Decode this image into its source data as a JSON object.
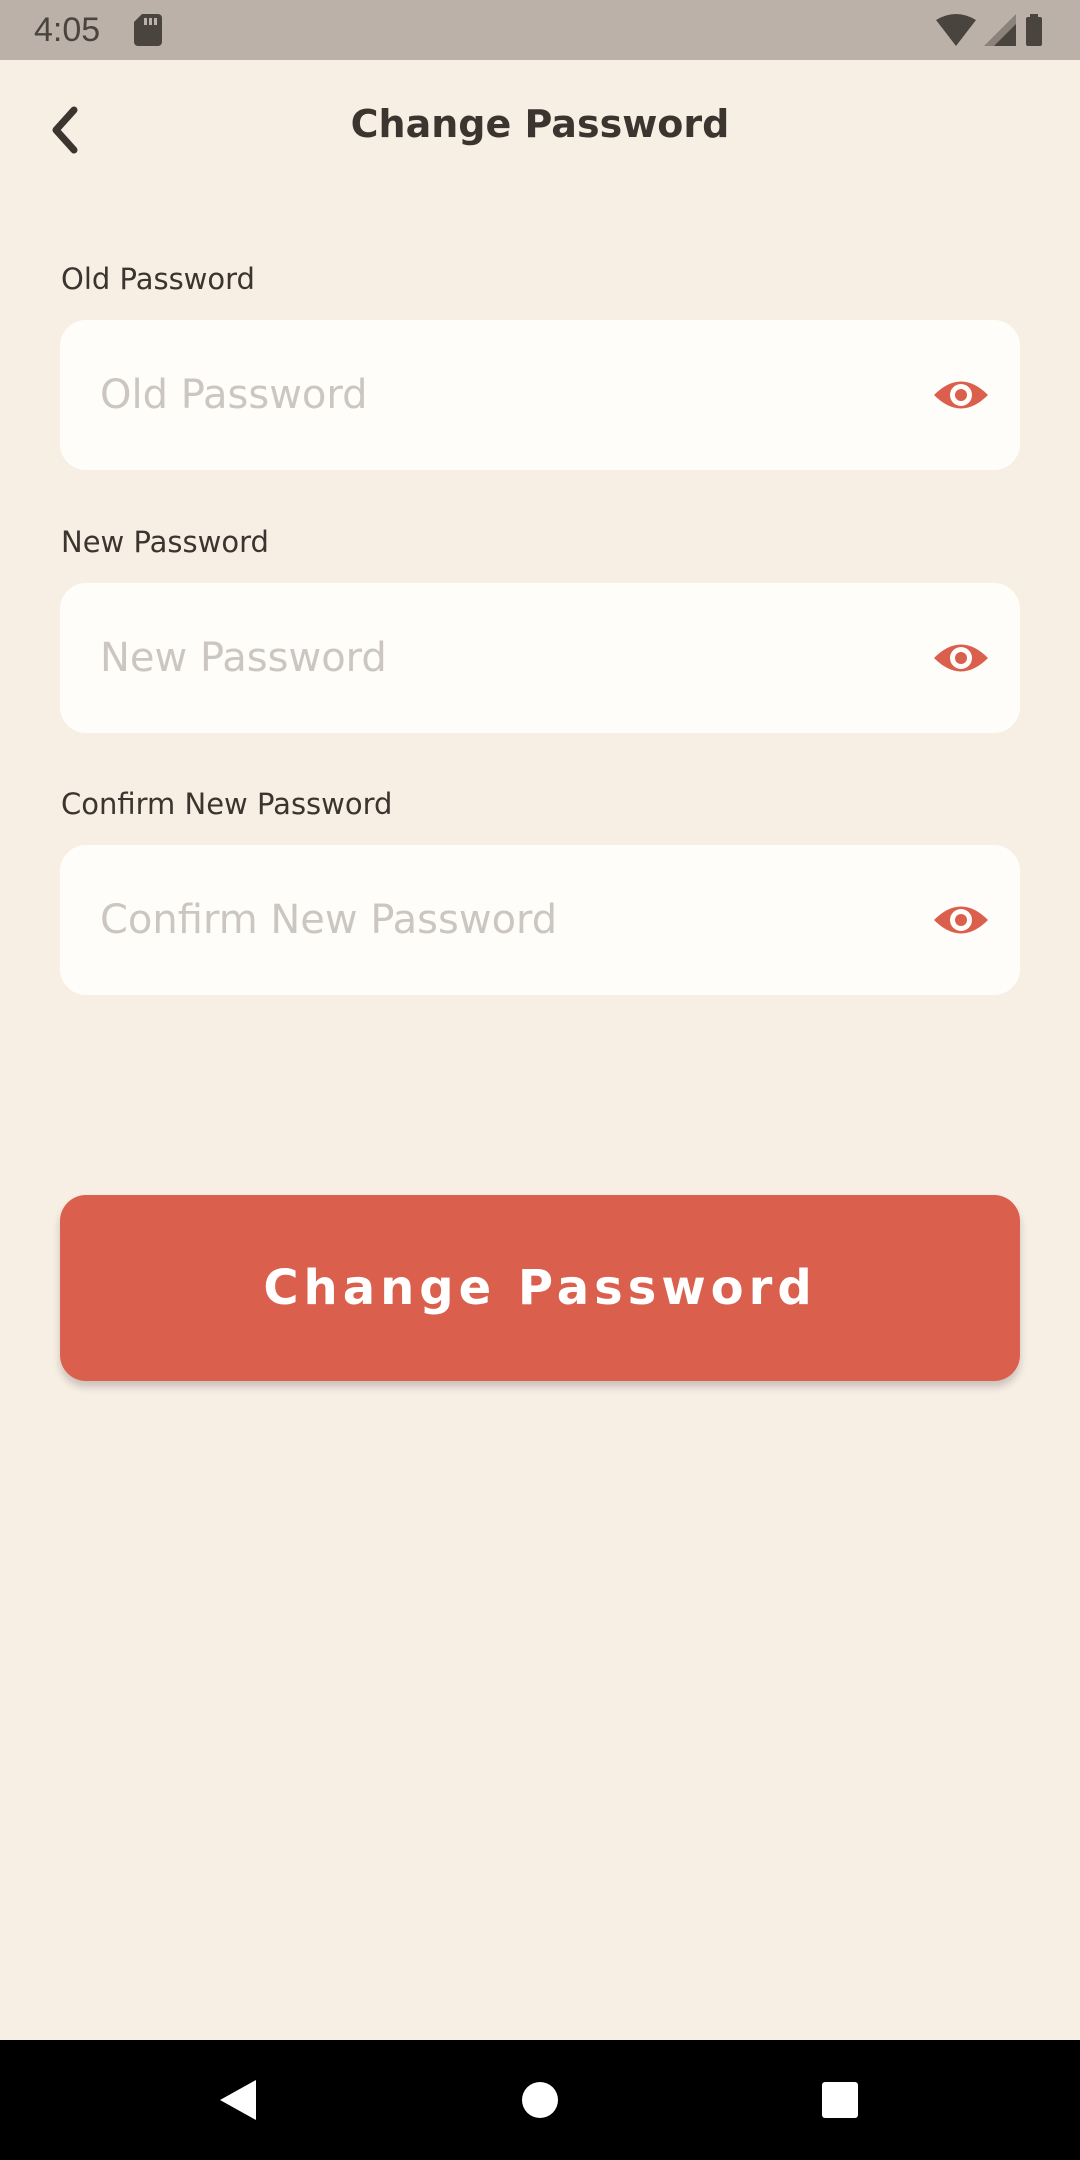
{
  "status_bar": {
    "time": "4:05"
  },
  "header": {
    "title": "Change Password",
    "back_icon": "chevron-left-icon"
  },
  "fields": [
    {
      "label": "Old Password",
      "placeholder": "Old Password",
      "value": "",
      "icon": "eye-icon"
    },
    {
      "label": "New Password",
      "placeholder": "New Password",
      "value": "",
      "icon": "eye-icon"
    },
    {
      "label": "Confirm New Password",
      "placeholder": "Confirm New Password",
      "value": "",
      "icon": "eye-icon"
    }
  ],
  "submit": {
    "label": "Change Password"
  },
  "colors": {
    "background": "#f7eee4",
    "accent": "#da604d",
    "field_background": "#fffdf9",
    "text": "#3c342f",
    "placeholder": "#cbc6c1"
  },
  "nav_bar": {
    "icons": [
      "back-triangle-icon",
      "home-circle-icon",
      "recents-square-icon"
    ]
  }
}
